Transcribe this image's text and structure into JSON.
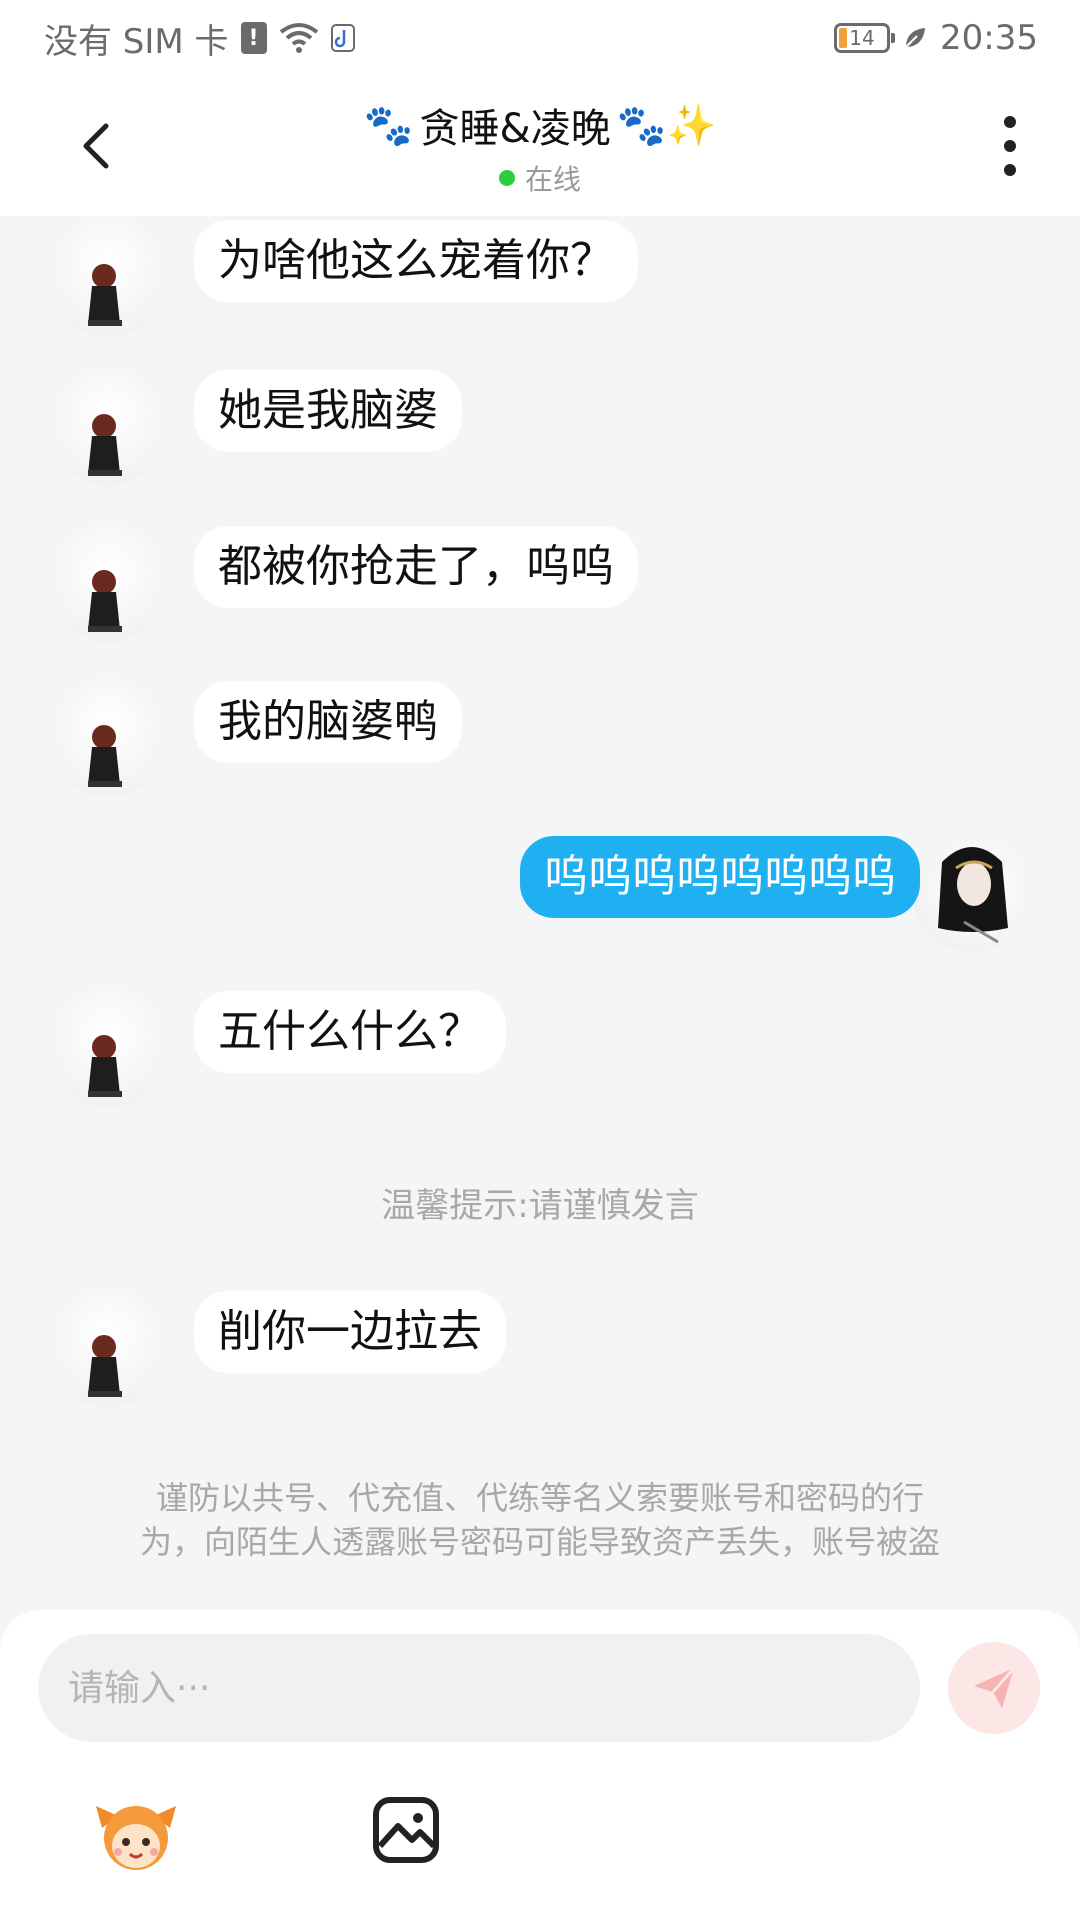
{
  "status_bar": {
    "carrier": "没有 SIM 卡",
    "alert_icon": "sim-alert-icon",
    "wifi_icon": "wifi-icon",
    "app_icon": "tiktok-icon",
    "battery_level": "14",
    "leaf_icon": "leaf-icon",
    "time": "20:35"
  },
  "header": {
    "title": "贪睡&凌晚",
    "title_decor_left": "🐾",
    "title_decor_right": "🐾✨",
    "presence": "在线",
    "presence_color": "#2ecc40"
  },
  "messages": [
    {
      "side": "left",
      "text": "为啥他这么宠着你？"
    },
    {
      "side": "left",
      "text": "她是我脑婆"
    },
    {
      "side": "left",
      "text": "都被你抢走了，呜呜"
    },
    {
      "side": "left",
      "text": "我的脑婆鸭"
    },
    {
      "side": "right",
      "text": "呜呜呜呜呜呜呜呜"
    },
    {
      "side": "left",
      "text": "五什么什么？"
    },
    {
      "side": "left",
      "text": "削你一边拉去"
    }
  ],
  "system_tip": "温馨提示:请谨慎发言",
  "safety_tip_line1": "谨防以共号、代充值、代练等名义索要账号和密码的行",
  "safety_tip_line2": "为，向陌生人透露账号密码可能导致资产丢失，账号被盗",
  "input": {
    "placeholder": "请输入···",
    "send_icon": "send-icon"
  },
  "toolbar": {
    "emoji_icon": "emoji-mascot-icon",
    "image_icon": "image-icon"
  },
  "colors": {
    "accent_bubble": "#1eb0f0",
    "background": "#f4f5f7",
    "send_button": "#fde6e6"
  }
}
